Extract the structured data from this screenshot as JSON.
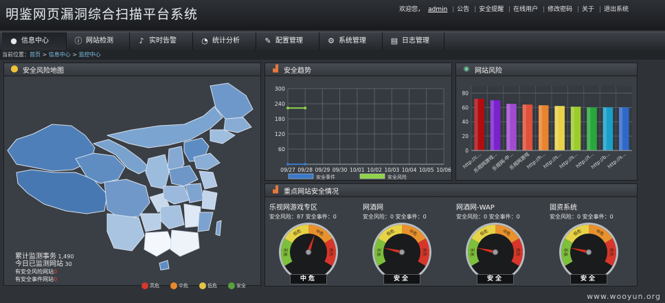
{
  "header": {
    "app_title": "明鉴网页漏洞综合扫描平台系统",
    "welcome": "欢迎您，",
    "username": "admin",
    "links": [
      "公告",
      "安全提醒",
      "在线用户",
      "修改密码",
      "关于",
      "退出系统"
    ]
  },
  "nav": {
    "tabs": [
      {
        "label": "信息中心",
        "icon": "chat-bubble-icon"
      },
      {
        "label": "网站检测",
        "icon": "info-icon"
      },
      {
        "label": "实时告警",
        "icon": "bell-icon"
      },
      {
        "label": "统计分析",
        "icon": "pie-icon"
      },
      {
        "label": "配置管理",
        "icon": "wrench-icon"
      },
      {
        "label": "系统管理",
        "icon": "gear-icon"
      },
      {
        "label": "日志管理",
        "icon": "log-icon"
      }
    ]
  },
  "breadcrumb": {
    "prefix": "当前位置：",
    "items": [
      "首页",
      "信息中心",
      "监控中心"
    ]
  },
  "map_panel": {
    "title": "安全风险地图",
    "stats": {
      "total_label": "累计监测事务",
      "total_value": "1,490",
      "today_label": "今日已监测网站",
      "today_value": "30",
      "risk_site_label": "有安全风险网站",
      "risk_site_value": "0",
      "event_site_label": "有安全事件网站",
      "event_site_value": "0"
    },
    "legend": [
      {
        "label": "高危",
        "color": "#d23a2c"
      },
      {
        "label": "中危",
        "color": "#e88a2c"
      },
      {
        "label": "低危",
        "color": "#e3c34a"
      },
      {
        "label": "安全",
        "color": "#5aa03c"
      }
    ]
  },
  "trend_panel": {
    "title": "安全趋势",
    "chart_data": {
      "type": "line",
      "x": [
        "09/27",
        "09/28",
        "09/29",
        "09/30",
        "10/01",
        "10/02",
        "10/03",
        "10/04",
        "10/05",
        "10/06"
      ],
      "ylim": [
        0,
        300
      ],
      "yticks": [
        60,
        120,
        180,
        240,
        300
      ],
      "series": [
        {
          "name": "安全事件",
          "color": "#3a78c8",
          "values": [
            0,
            0
          ]
        },
        {
          "name": "安全风险",
          "color": "#8fd24a",
          "values": [
            223,
            223
          ]
        }
      ]
    }
  },
  "risk_panel": {
    "title": "网站风险",
    "chart_data": {
      "type": "bar",
      "yticks": [
        0,
        20,
        40,
        60,
        80
      ],
      "ylim": [
        0,
        90
      ],
      "categories": [
        "http://c...",
        "乐视网游戏...",
        "乐视网-中...",
        "乐视网游戏",
        "http://h...",
        "http://s...",
        "http://s...",
        "http://t...",
        "http://b...",
        "http://s..."
      ],
      "values": [
        72,
        70,
        65,
        64,
        63,
        62,
        61,
        60,
        60,
        60
      ],
      "colors": [
        "#b10d10",
        "#7b22cc",
        "#a04bd0",
        "#e0503a",
        "#e8832e",
        "#e8d24a",
        "#9ccc2a",
        "#28a83a",
        "#1aa0c8",
        "#2f68c8"
      ]
    }
  },
  "sites_panel": {
    "title": "重点网站安全情况",
    "sites": [
      {
        "name": "乐视网游戏专区",
        "stats": "安全风险：87 安全事件：0",
        "status": "中危",
        "level": 0.58
      },
      {
        "name": "网酒网",
        "stats": "安全风险：0 安全事件：0",
        "status": "安全",
        "level": 0.18
      },
      {
        "name": "网酒网-WAP",
        "stats": "安全风险：0 安全事件：0",
        "status": "安全",
        "level": 0.18
      },
      {
        "name": "固资系统",
        "stats": "安全风险：0 安全事件：0",
        "status": "安全",
        "level": 0.18
      }
    ],
    "gauge_zones": [
      "安全",
      "低危",
      "中危",
      "高危"
    ]
  },
  "watermark": "www.wooyun.org"
}
